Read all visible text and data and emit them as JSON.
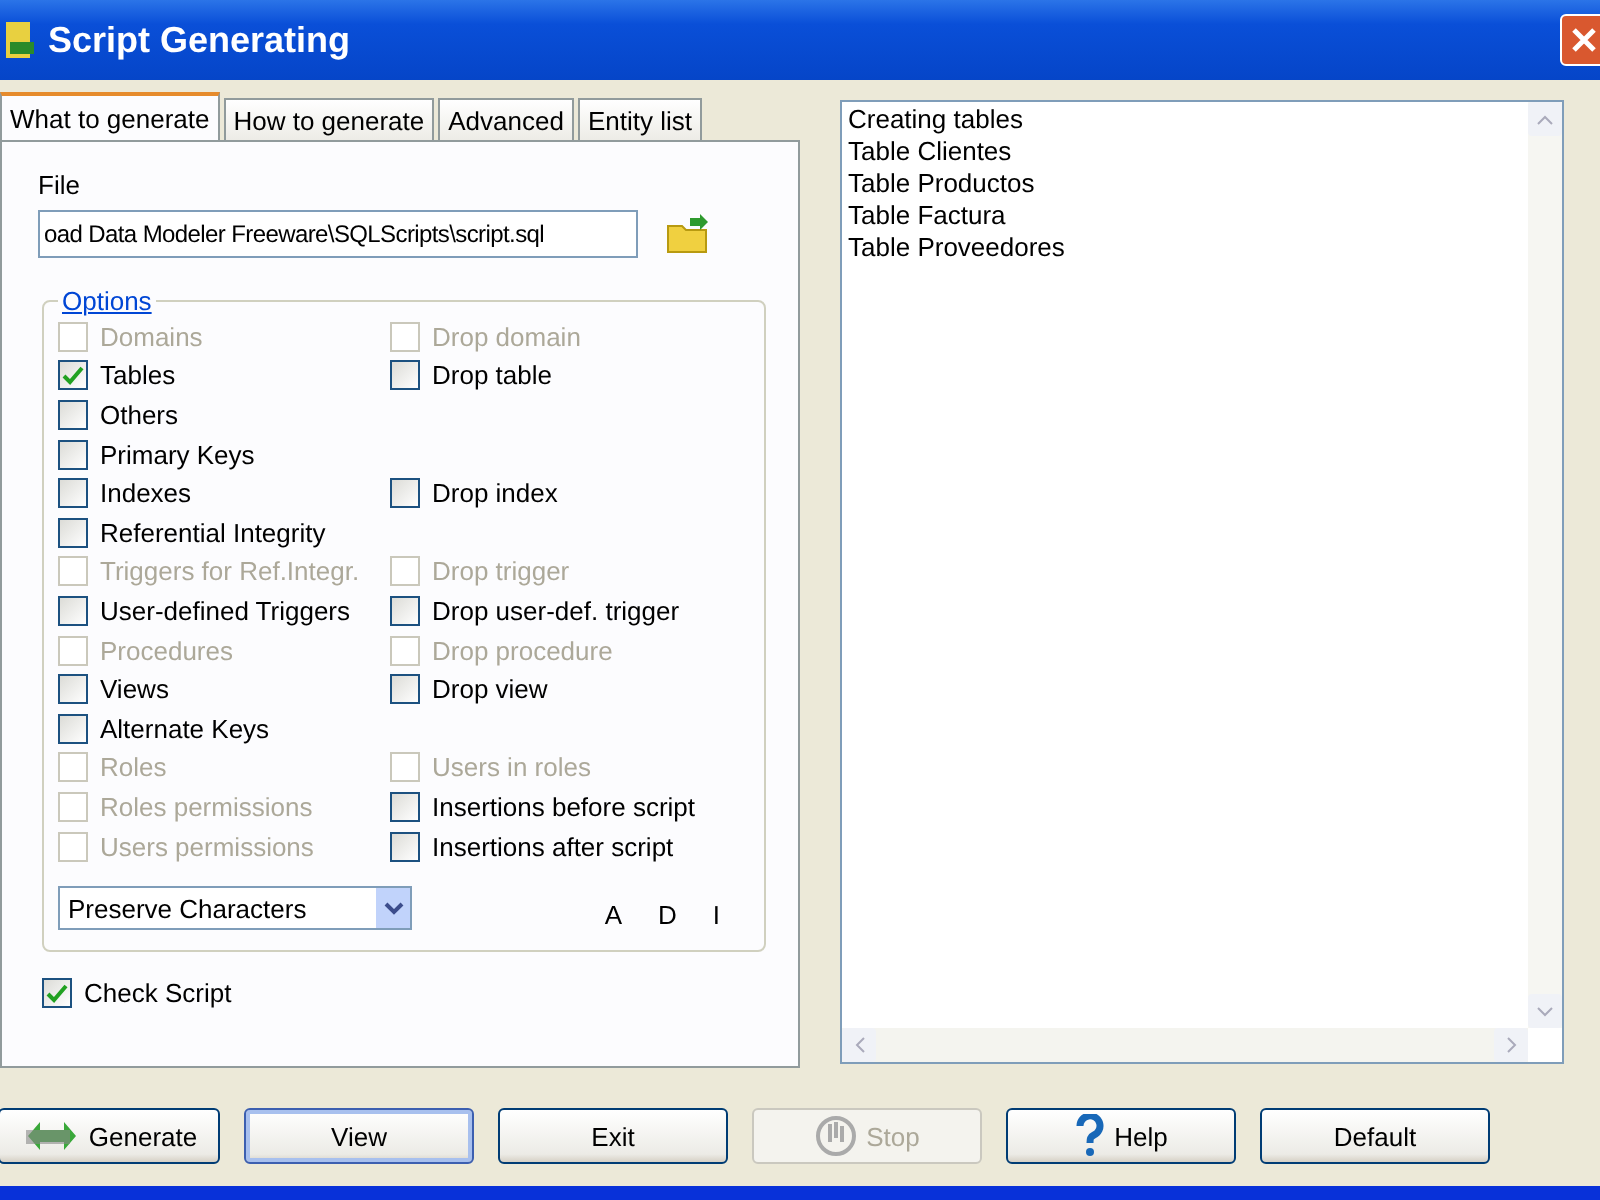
{
  "window": {
    "title": "Script Generating"
  },
  "tabs": [
    {
      "label": "What to generate",
      "selected": true
    },
    {
      "label": "How to generate",
      "selected": false
    },
    {
      "label": "Advanced",
      "selected": false
    },
    {
      "label": "Entity list",
      "selected": false
    }
  ],
  "file": {
    "label": "File",
    "value": "oad Data Modeler Freeware\\SQLScripts\\script.sql"
  },
  "options": {
    "title": "Options",
    "rows": [
      {
        "left": {
          "label": "Domains",
          "checked": false,
          "disabled": true
        },
        "right": {
          "label": "Drop domain",
          "checked": false,
          "disabled": true
        }
      },
      {
        "left": {
          "label": "Tables",
          "checked": true,
          "disabled": false
        },
        "right": {
          "label": "Drop table",
          "checked": false,
          "disabled": false
        }
      },
      {
        "left": {
          "label": "Others",
          "checked": false,
          "disabled": false
        }
      },
      {
        "left": {
          "label": "Primary Keys",
          "checked": false,
          "disabled": false
        }
      },
      {
        "left": {
          "label": "Indexes",
          "checked": false,
          "disabled": false
        },
        "right": {
          "label": "Drop index",
          "checked": false,
          "disabled": false
        }
      },
      {
        "left": {
          "label": "Referential Integrity",
          "checked": false,
          "disabled": false
        }
      },
      {
        "left": {
          "label": "Triggers for Ref.Integr.",
          "checked": false,
          "disabled": true
        },
        "right": {
          "label": "Drop trigger",
          "checked": false,
          "disabled": true
        }
      },
      {
        "left": {
          "label": "User-defined Triggers",
          "checked": false,
          "disabled": false
        },
        "right": {
          "label": "Drop user-def. trigger",
          "checked": false,
          "disabled": false
        }
      },
      {
        "left": {
          "label": "Procedures",
          "checked": false,
          "disabled": true
        },
        "right": {
          "label": "Drop procedure",
          "checked": false,
          "disabled": true
        }
      },
      {
        "left": {
          "label": "Views",
          "checked": false,
          "disabled": false
        },
        "right": {
          "label": "Drop view",
          "checked": false,
          "disabled": false
        }
      },
      {
        "left": {
          "label": "Alternate Keys",
          "checked": false,
          "disabled": false
        }
      },
      {
        "left": {
          "label": "Roles",
          "checked": false,
          "disabled": true
        },
        "right": {
          "label": "Users in roles",
          "checked": false,
          "disabled": true
        }
      },
      {
        "left": {
          "label": "Roles permissions",
          "checked": false,
          "disabled": true
        },
        "right": {
          "label": "Insertions before script",
          "checked": false,
          "disabled": false
        }
      },
      {
        "left": {
          "label": "Users permissions",
          "checked": false,
          "disabled": true
        },
        "right": {
          "label": "Insertions after script",
          "checked": false,
          "disabled": false
        }
      }
    ],
    "case_select": {
      "value": "Preserve Characters"
    },
    "letters": [
      "A",
      "D",
      "I"
    ]
  },
  "check_script": {
    "label": "Check Script",
    "checked": true
  },
  "output_lines": [
    "Creating tables",
    "Table Clientes",
    "Table Productos",
    "Table Factura",
    "Table Proveedores"
  ],
  "buttons": [
    {
      "label": "Generate",
      "kind": "sql",
      "disabled": false,
      "focused": false
    },
    {
      "label": "View",
      "kind": "plain",
      "disabled": false,
      "focused": true
    },
    {
      "label": "Exit",
      "kind": "plain",
      "disabled": false,
      "focused": false
    },
    {
      "label": "Stop",
      "kind": "stop",
      "disabled": true,
      "focused": false
    },
    {
      "label": "Help",
      "kind": "help",
      "disabled": false,
      "focused": false
    },
    {
      "label": "Default",
      "kind": "plain",
      "disabled": false,
      "focused": false
    }
  ]
}
